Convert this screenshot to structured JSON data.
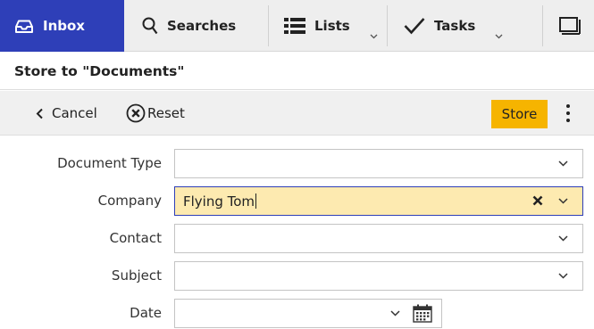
{
  "nav": {
    "tabs": [
      {
        "label": "Inbox",
        "icon": "inbox-icon",
        "active": true
      },
      {
        "label": "Searches",
        "icon": "search-icon"
      },
      {
        "label": "Lists",
        "icon": "list-icon"
      },
      {
        "label": "Tasks",
        "icon": "checkmark-icon"
      }
    ],
    "window_icon": "window-icon"
  },
  "title": "Store to \"Documents\"",
  "toolbar": {
    "cancel_label": "Cancel",
    "reset_label": "Reset",
    "store_label": "Store"
  },
  "form": {
    "fields": [
      {
        "label": "Document Type",
        "value": ""
      },
      {
        "label": "Company",
        "value": "Flying Tom"
      },
      {
        "label": "Contact",
        "value": ""
      },
      {
        "label": "Subject",
        "value": ""
      },
      {
        "label": "Date",
        "value": ""
      }
    ]
  },
  "colors": {
    "active_tab": "#2e3fb8",
    "store_button": "#f6b400",
    "active_field": "#fdeab0"
  }
}
